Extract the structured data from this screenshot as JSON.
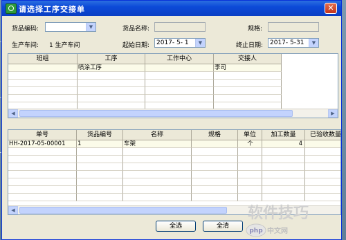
{
  "window": {
    "title": "请选择工序交接单"
  },
  "filters": {
    "product_code_label": "货品编码:",
    "product_code_value": "",
    "product_name_label": "货品名称:",
    "product_name_value": "",
    "spec_label": "规格:",
    "spec_value": "",
    "workshop_label": "生产车间:",
    "workshop_value": "1 生产车间",
    "start_date_label": "起始日期:",
    "start_date_value": "2017- 5- 1",
    "end_date_label": "终止日期:",
    "end_date_value": "2017- 5-31"
  },
  "top_grid": {
    "columns": [
      "班组",
      "工序",
      "工作中心",
      "交接人"
    ],
    "rows": [
      {
        "team": "",
        "process": "喷涂工序",
        "work_center": "",
        "handover": "李司"
      }
    ]
  },
  "bottom_grid": {
    "columns": [
      "单号",
      "货品编号",
      "名称",
      "规格",
      "单位",
      "加工数量",
      "已验收数量"
    ],
    "rows": [
      {
        "order_no": "HH-2017-05-00001",
        "code": "1",
        "name": "车架",
        "spec": "",
        "unit": "个",
        "qty": "4",
        "accepted": ""
      }
    ]
  },
  "buttons": {
    "select_all": "全选",
    "clear_all": "全清"
  },
  "watermark": {
    "text": "软件技巧",
    "logo": "php中文网"
  }
}
